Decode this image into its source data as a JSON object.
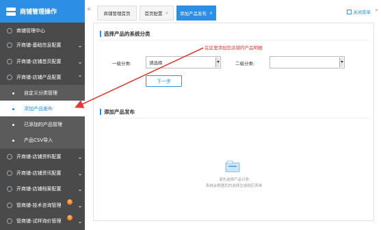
{
  "sidebar": {
    "header_title": "商铺管理操作",
    "items": [
      {
        "label": "商铺管理中心"
      },
      {
        "label": "开商铺-基础信息配置"
      },
      {
        "label": "开商铺-店铺首页配置"
      },
      {
        "label": "开商铺-店铺产品配置"
      },
      {
        "label": "自定义分类管理"
      },
      {
        "label": "添加产品发布"
      },
      {
        "label": "已添加的产品管理"
      },
      {
        "label": "产品CSV导入"
      },
      {
        "label": "开商铺-店铺资料配置"
      },
      {
        "label": "开商铺-店铺资讯配置"
      },
      {
        "label": "开商铺-店铺档案配置"
      },
      {
        "label": "管商铺-技术咨询管理",
        "badge": "0"
      },
      {
        "label": "管商铺-试样询价管理",
        "badge": "0"
      }
    ]
  },
  "tabs": [
    {
      "label": "商铺管理首页"
    },
    {
      "label": "首页配置",
      "close": "×"
    },
    {
      "label": "添加产品发布",
      "close": "×"
    }
  ],
  "close_menu": "关闭菜单",
  "section1": {
    "title": "选择产品的系统分类",
    "level1_label": "一级分类:",
    "level1_value": "请选择",
    "level2_label": "二级分类:",
    "level2_value": "",
    "next_button": "下一步"
  },
  "annotation": "在这里添加您店铺的产品明细",
  "section2": {
    "title": "添加产品发布",
    "empty_line1": "请先选择产品分类",
    "empty_line2": "系统会根据您的选择生成相应表单"
  },
  "colors": {
    "accent": "#2d8ee6",
    "sidebar_bg": "#4a4a4a",
    "annotation": "#e53935"
  }
}
